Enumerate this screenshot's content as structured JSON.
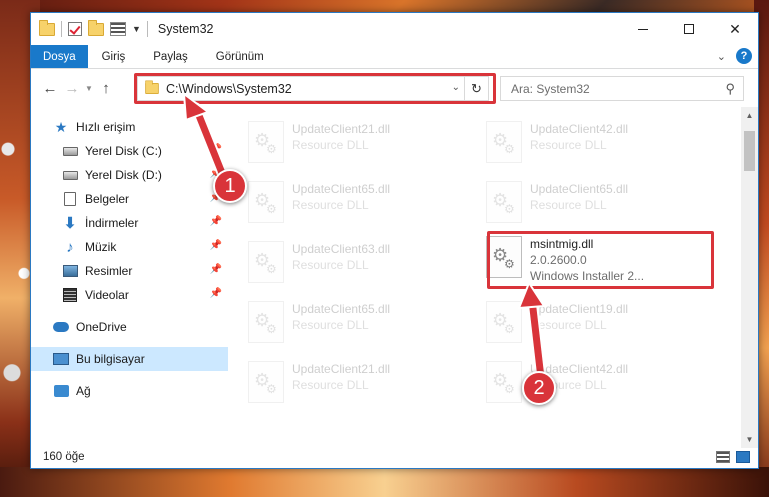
{
  "window": {
    "title": "System32"
  },
  "ribbon": {
    "tabs": [
      "Dosya",
      "Giriş",
      "Paylaş",
      "Görünüm"
    ]
  },
  "address": {
    "path": "C:\\Windows\\System32",
    "search_placeholder": "Ara: System32"
  },
  "sidebar": {
    "items": [
      {
        "label": "Hızlı erişim",
        "icon": "star-icon"
      },
      {
        "label": "Yerel Disk (C:)",
        "icon": "disk-icon"
      },
      {
        "label": "Yerel Disk (D:)",
        "icon": "disk-icon"
      },
      {
        "label": "Belgeler",
        "icon": "documents-icon"
      },
      {
        "label": "İndirmeler",
        "icon": "download-icon"
      },
      {
        "label": "Müzik",
        "icon": "music-icon"
      },
      {
        "label": "Resimler",
        "icon": "pictures-icon"
      },
      {
        "label": "Videolar",
        "icon": "videos-icon"
      },
      {
        "label": "OneDrive",
        "icon": "cloud-icon"
      },
      {
        "label": "Bu bilgisayar",
        "icon": "computer-icon"
      },
      {
        "label": "Ağ",
        "icon": "network-icon"
      }
    ]
  },
  "files": [
    {
      "name": "UpdateClient21.dll",
      "sub": "Resource DLL",
      "faded": true
    },
    {
      "name": "UpdateClient42.dll",
      "sub": "Resource DLL",
      "faded": true
    },
    {
      "name": "UpdateClient65.dll",
      "sub": "Resource DLL",
      "faded": true
    },
    {
      "name": "UpdateClient65.dll",
      "sub": "Resource DLL",
      "faded": true
    },
    {
      "name": "UpdateClient63.dll",
      "sub": "Resource DLL",
      "faded": true
    },
    {
      "name": "msintmig.dll",
      "version": "2.0.2600.0",
      "sub": "Windows Installer 2...",
      "faded": false
    },
    {
      "name": "UpdateClient65.dll",
      "sub": "Resource DLL",
      "faded": true
    },
    {
      "name": "UpdateClient19.dll",
      "sub": "Resource DLL",
      "faded": true
    },
    {
      "name": "UpdateClient21.dll",
      "sub": "Resource DLL",
      "faded": true
    },
    {
      "name": "UpdateClient42.dll",
      "sub": "Resource DLL",
      "faded": true
    }
  ],
  "status": {
    "count": "160 öğe"
  },
  "callouts": [
    "1",
    "2"
  ],
  "colors": {
    "accent": "#1979ca",
    "highlight": "#d9343a",
    "selected": "#cce8ff"
  }
}
